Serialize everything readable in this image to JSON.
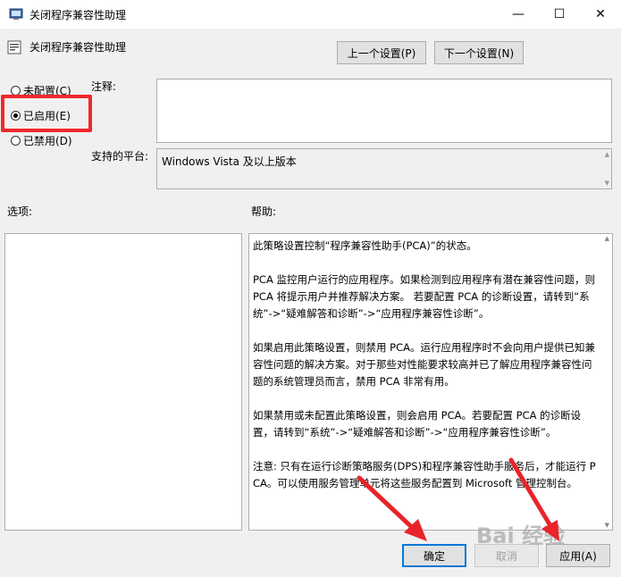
{
  "window": {
    "title": "关闭程序兼容性助理",
    "minimize_symbol": "—",
    "maximize_symbol": "☐",
    "close_symbol": "✕"
  },
  "header": {
    "title": "关闭程序兼容性助理",
    "prev_button": "上一个设置(P)",
    "next_button": "下一个设置(N)"
  },
  "state": {
    "options": [
      {
        "label": "未配置(C)",
        "checked": false
      },
      {
        "label": "已启用(E)",
        "checked": true
      },
      {
        "label": "已禁用(D)",
        "checked": false
      }
    ]
  },
  "comment": {
    "label": "注释:",
    "value": ""
  },
  "platform": {
    "label": "支持的平台:",
    "value": "Windows Vista 及以上版本"
  },
  "options_section": {
    "label": "选项:"
  },
  "help_section": {
    "label": "帮助:",
    "paragraphs": [
      "此策略设置控制“程序兼容性助手(PCA)”的状态。",
      "PCA 监控用户运行的应用程序。如果检测到应用程序有潜在兼容性问题，则 PCA 将提示用户并推荐解决方案。 若要配置 PCA 的诊断设置，请转到“系统”->“疑难解答和诊断”->“应用程序兼容性诊断”。",
      "如果启用此策略设置，则禁用 PCA。运行应用程序时不会向用户提供已知兼容性问题的解决方案。对于那些对性能要求较高并已了解应用程序兼容性问题的系统管理员而言，禁用 PCA 非常有用。",
      "如果禁用或未配置此策略设置，则会启用 PCA。若要配置 PCA 的诊断设置，请转到“系统”->“疑难解答和诊断”->“应用程序兼容性诊断”。",
      "注意: 只有在运行诊断策略服务(DPS)和程序兼容性助手服务后，才能运行 PCA。可以使用服务管理单元将这些服务配置到 Microsoft 管理控制台。"
    ]
  },
  "footer": {
    "ok_button": "确定",
    "cancel_button": "取消",
    "apply_button": "应用(A)"
  },
  "watermark": "Bai 经验",
  "colors": {
    "highlight_box": "#f0282d",
    "arrow": "#e8242a"
  }
}
